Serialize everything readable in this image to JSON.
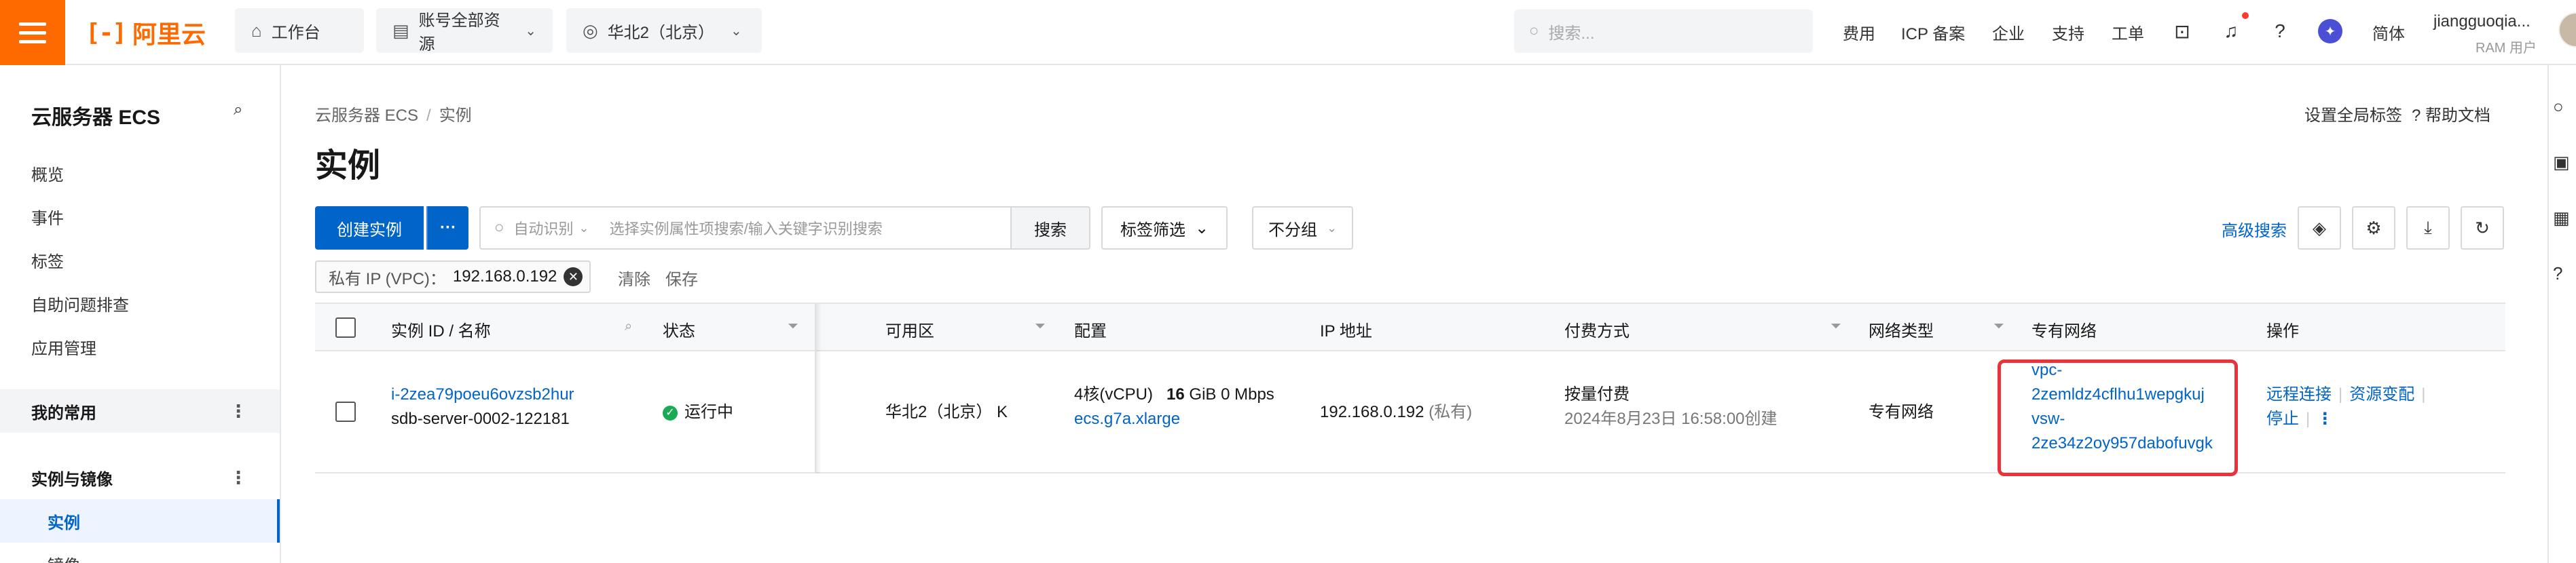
{
  "topbar": {
    "brand": "阿里云",
    "workbench": "工作台",
    "resource_scope": "账号全部资源",
    "region": "华北2（北京）",
    "search_placeholder": "搜索...",
    "links": [
      "费用",
      "ICP 备案",
      "企业",
      "支持",
      "工单"
    ],
    "language": "简体",
    "user_name": "jiangguoqia...",
    "user_role": "RAM 用户"
  },
  "sidebar": {
    "title": "云服务器 ECS",
    "items": [
      "概览",
      "事件",
      "标签",
      "自助问题排查",
      "应用管理"
    ],
    "group_favorites": "我的常用",
    "group_instances": "实例与镜像",
    "active_item": "实例",
    "next_item": "镜像"
  },
  "main": {
    "breadcrumb": [
      "云服务器 ECS",
      "实例"
    ],
    "title": "实例",
    "global_tags": "设置全局标签",
    "help_docs": "帮助文档",
    "create_button": "创建实例",
    "more_button": "···",
    "search_mode": "自动识别",
    "search_placeholder": "选择实例属性项搜索/输入关键字识别搜索",
    "search_button": "搜索",
    "tag_filter": "标签筛选",
    "group_select": "不分组",
    "advanced_search": "高级搜索",
    "filter_key": "私有 IP (VPC)：",
    "filter_value": "192.168.0.192",
    "clear": "清除",
    "save": "保存"
  },
  "table": {
    "headers": {
      "id_name": "实例 ID / 名称",
      "status": "状态",
      "zone": "可用区",
      "config": "配置",
      "ip": "IP 地址",
      "billing": "付费方式",
      "network_type": "网络类型",
      "vpc": "专有网络",
      "ops": "操作"
    },
    "rows": [
      {
        "instance_id": "i-2zea79poeu6ovzsb2hur",
        "instance_name": "sdb-server-0002-122181",
        "status": "运行中",
        "zone": "华北2（北京） K",
        "cpu": "4核(vCPU)",
        "mem_num": "16",
        "mem_rest": "GiB 0 Mbps",
        "spec": "ecs.g7a.xlarge",
        "ip": "192.168.0.192",
        "ip_type": "(私有)",
        "billing": "按量付费",
        "created": "2024年8月23日 16:58:00创建",
        "network_type": "专有网络",
        "vpc_line1": "vpc-",
        "vpc_line2": "2zemldz4cflhu1wepgkuj",
        "vsw_line1": "vsw-",
        "vsw_line2": "2ze34z2oy957dabofuvgk",
        "op_remote": "远程连接",
        "op_resources": "资源变配",
        "op_stop": "停止"
      }
    ]
  },
  "colors": {
    "brand_orange": "#ff6a00",
    "primary_blue": "#0064c8",
    "running_green": "#1aaa55",
    "highlight_red": "#e8333b"
  }
}
